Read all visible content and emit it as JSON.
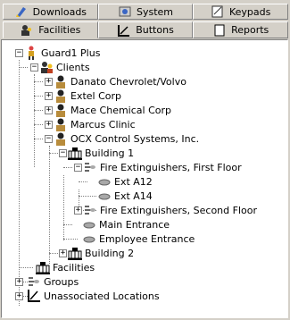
{
  "tabs": {
    "back_row": [
      {
        "label": "Downloads",
        "icon": "downloads-icon"
      },
      {
        "label": "System",
        "icon": "system-icon"
      },
      {
        "label": "Keypads",
        "icon": "keypads-icon"
      }
    ],
    "front_row": [
      {
        "label": "Facilities",
        "icon": "facilities-icon",
        "selected": true
      },
      {
        "label": "Buttons",
        "icon": "buttons-icon"
      },
      {
        "label": "Reports",
        "icon": "reports-icon"
      }
    ]
  },
  "tree": {
    "root": "Guard1 Plus",
    "clients": "Clients",
    "client_list": [
      "Danato Chevrolet/Volvo",
      "Extel Corp",
      "Mace Chemical Corp",
      "Marcus Clinic",
      "OCX Control Systems, Inc."
    ],
    "building1": "Building 1",
    "group_first": "Fire Extinguishers, First Floor",
    "ext_a12": "Ext A12",
    "ext_a14": "Ext A14",
    "group_second": "Fire Extinguishers, Second Floor",
    "main_entrance": "Main Entrance",
    "employee_entrance": "Employee Entrance",
    "building2": "Building 2",
    "facilities": "Facilities",
    "groups": "Groups",
    "unassociated": "Unassociated Locations"
  }
}
